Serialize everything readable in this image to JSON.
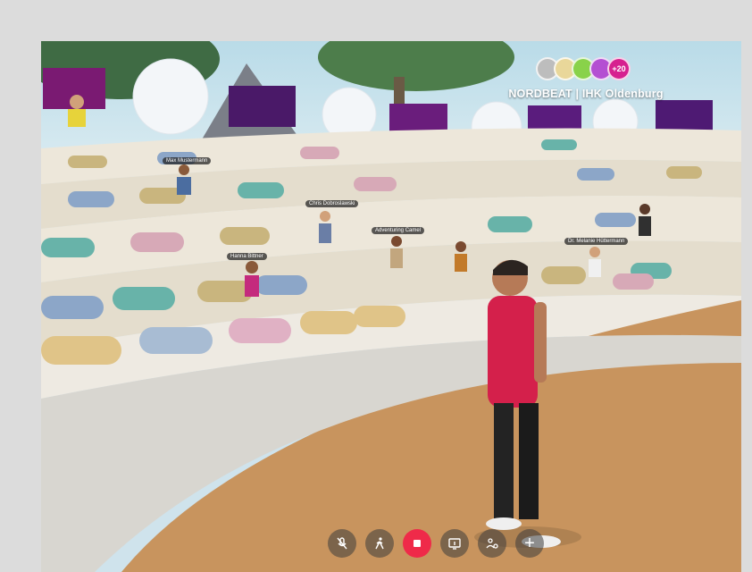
{
  "room": {
    "title": "NORDBEAT | IHK Oldenburg",
    "participant_count": "+20"
  },
  "nametags": [
    "Hanna Bittner",
    "Adventuring Camel",
    "Chris Dobroslawski",
    "Dr. Melanie Hüttermann",
    "Max Mustermann"
  ],
  "toolbar": {
    "mic_icon": "mic-off-icon",
    "move_icon": "walking-person-icon",
    "record_icon": "stop-icon",
    "screen_icon": "screen-share-icon",
    "people_icon": "people-settings-icon",
    "add_icon": "plus-icon",
    "add_label": "+"
  },
  "colors": {
    "accent": "#ef2a49",
    "count_badge": "#d6208f"
  }
}
